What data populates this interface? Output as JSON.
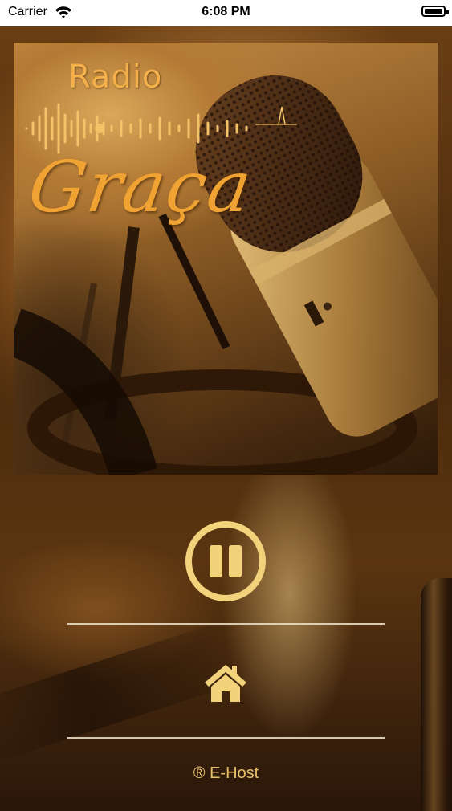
{
  "status_bar": {
    "carrier": "Carrier",
    "time": "6:08 PM",
    "wifi_icon": "wifi-icon",
    "battery_icon": "battery-icon"
  },
  "artwork": {
    "title_line1": "Radio",
    "title_line2": "Graça",
    "image_icon": "studio-microphone"
  },
  "player": {
    "state": "playing",
    "control_icon": "pause-icon",
    "accent_color": "#f2d27a"
  },
  "nav": {
    "home_icon": "home-icon"
  },
  "footer": {
    "text": "® E-Host"
  }
}
